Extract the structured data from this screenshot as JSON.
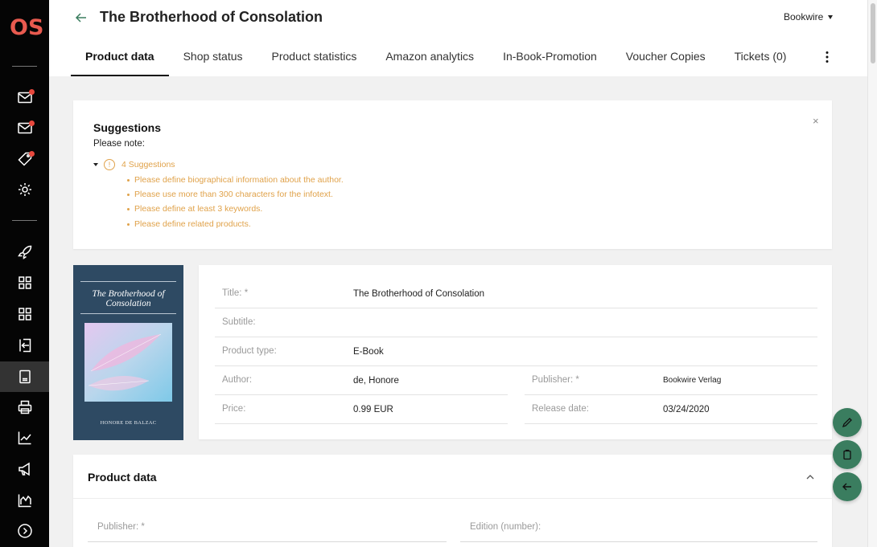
{
  "app": {
    "logo": "OS"
  },
  "header": {
    "title": "The Brotherhood of Consolation",
    "publisher_select": "Bookwire"
  },
  "tabs": [
    {
      "label": "Product data",
      "active": true
    },
    {
      "label": "Shop status"
    },
    {
      "label": "Product statistics"
    },
    {
      "label": "Amazon analytics"
    },
    {
      "label": "In-Book-Promotion"
    },
    {
      "label": "Voucher Copies"
    },
    {
      "label": "Tickets (0)"
    }
  ],
  "sidebar": {
    "icons": [
      "mail-icon",
      "mail-icon",
      "tag-icon",
      "settings-icon",
      "rocket-icon",
      "grid-icon",
      "grid-icon",
      "import-icon",
      "product-icon",
      "print-icon",
      "chart-icon",
      "megaphone-icon",
      "stats-icon",
      "chevron-right-circle-icon"
    ]
  },
  "suggestions": {
    "title": "Suggestions",
    "note": "Please note:",
    "count_label": "4 Suggestions",
    "items": [
      "Please define biographical information about the author.",
      "Please use more than 300 characters for the infotext.",
      "Please define at least 3 keywords.",
      "Please define related products."
    ],
    "close": "×"
  },
  "cover": {
    "title_line1": "The Brotherhood of",
    "title_line2": "Consolation",
    "author": "HONORE DE BALZAC"
  },
  "product": {
    "title_label": "Title: *",
    "title_value": "The Brotherhood of Consolation",
    "subtitle_label": "Subtitle:",
    "type_label": "Product type:",
    "type_value": "E-Book",
    "author_label": "Author:",
    "author_value": "de, Honore",
    "publisher_label": "Publisher: *",
    "publisher_value": "Bookwire Verlag",
    "price_label": "Price:",
    "price_value": "0.99 EUR",
    "release_label": "Release date:",
    "release_value": "03/24/2020"
  },
  "product_data": {
    "title": "Product data",
    "publisher_label": "Publisher: *",
    "edition_label": "Edition (number):"
  },
  "colors": {
    "sidebar_bg": "#050505",
    "logo": "#e85a4f",
    "warning": "#e0a24a",
    "fab": "#3a7d5f",
    "cover": "#2e4a63"
  }
}
